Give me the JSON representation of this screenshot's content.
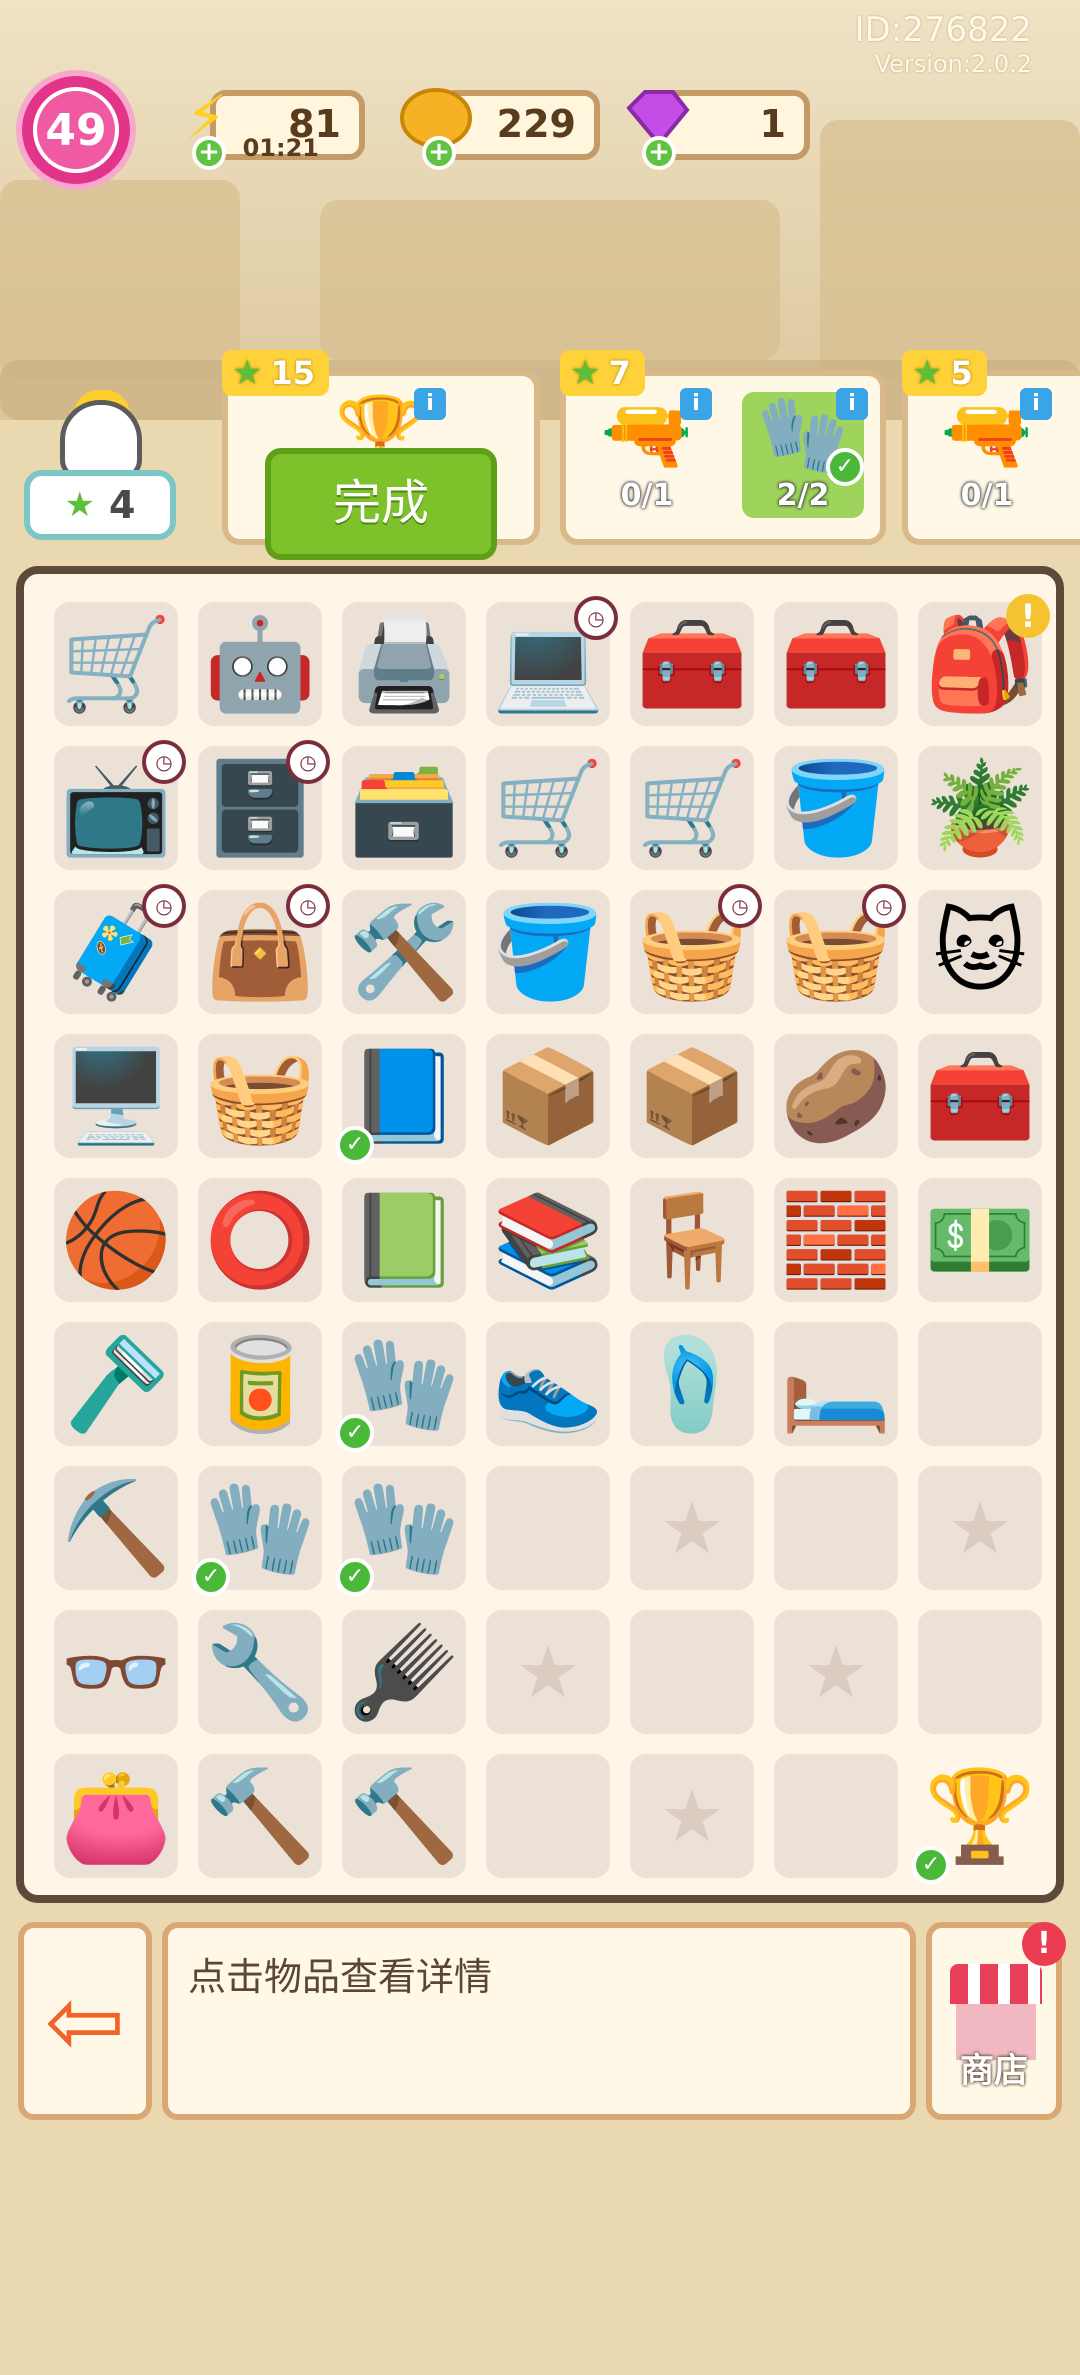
{
  "header": {
    "id_text": "ID:276822",
    "version_text": "Version:2.0.2",
    "level": "49",
    "energy": {
      "value": "81",
      "timer": "01:21"
    },
    "coins": {
      "value": "229"
    },
    "gems": {
      "value": "1"
    }
  },
  "hen": {
    "stars": "4"
  },
  "tasks": [
    {
      "stars": "15",
      "button_label": "完成"
    },
    {
      "stars": "7",
      "slots": [
        {
          "item": "drill",
          "count": "0/1"
        },
        {
          "item": "gloves",
          "count": "2/2"
        }
      ]
    },
    {
      "stars": "5",
      "slots": [
        {
          "item": "drill",
          "count": "0/1"
        }
      ]
    }
  ],
  "inventory": [
    {
      "icon": "🛒"
    },
    {
      "icon": "🤖"
    },
    {
      "icon": "🖨️"
    },
    {
      "icon": "💻",
      "badge": "clock"
    },
    {
      "icon": "🧰"
    },
    {
      "icon": "🧰"
    },
    {
      "icon": "🎒",
      "badge": "alert"
    },
    {
      "icon": "📺",
      "badge": "clock"
    },
    {
      "icon": "🗄️",
      "badge": "clock"
    },
    {
      "icon": "🗃️"
    },
    {
      "icon": "🛒"
    },
    {
      "icon": "🛒"
    },
    {
      "icon": "🪣"
    },
    {
      "icon": "🪴"
    },
    {
      "icon": "🧳",
      "badge": "clock"
    },
    {
      "icon": "👜",
      "badge": "clock"
    },
    {
      "icon": "🛠️"
    },
    {
      "icon": "🪣"
    },
    {
      "icon": "🧺",
      "badge": "clock"
    },
    {
      "icon": "🧺",
      "badge": "clock"
    },
    {
      "icon": "🐱"
    },
    {
      "icon": "🖥️"
    },
    {
      "icon": "🧺"
    },
    {
      "icon": "📘",
      "badge": "check"
    },
    {
      "icon": "📦"
    },
    {
      "icon": "📦"
    },
    {
      "icon": "🥔"
    },
    {
      "icon": "🧰"
    },
    {
      "icon": "🏀"
    },
    {
      "icon": "⭕"
    },
    {
      "icon": "📗"
    },
    {
      "icon": "📚"
    },
    {
      "icon": "🪑"
    },
    {
      "icon": "🧱"
    },
    {
      "icon": "💵"
    },
    {
      "icon": "🪒"
    },
    {
      "icon": "🥫"
    },
    {
      "icon": "🧤",
      "badge": "check"
    },
    {
      "icon": "👟"
    },
    {
      "icon": "🩴"
    },
    {
      "icon": "🛏️"
    },
    {
      "icon": "",
      "empty": true
    },
    {
      "icon": "⛏️"
    },
    {
      "icon": "🧤",
      "badge": "check"
    },
    {
      "icon": "🧤",
      "badge": "check"
    },
    {
      "icon": "",
      "empty": true
    },
    {
      "icon": "",
      "star": true
    },
    {
      "icon": "",
      "empty": true
    },
    {
      "icon": "",
      "star": true
    },
    {
      "icon": "👓"
    },
    {
      "icon": "🔧"
    },
    {
      "icon": "🪮"
    },
    {
      "icon": "",
      "star": true
    },
    {
      "icon": "",
      "empty": true
    },
    {
      "icon": "",
      "star": true
    },
    {
      "icon": "",
      "empty": true
    },
    {
      "icon": "👛"
    },
    {
      "icon": "🔨"
    },
    {
      "icon": "🔨"
    },
    {
      "icon": "",
      "empty": true
    },
    {
      "icon": "",
      "star": true
    },
    {
      "icon": "",
      "empty": true
    },
    {
      "icon": "🏆",
      "badge": "check",
      "plain": true
    }
  ],
  "footer": {
    "hint": "点击物品查看详情",
    "shop_label": "商店"
  }
}
